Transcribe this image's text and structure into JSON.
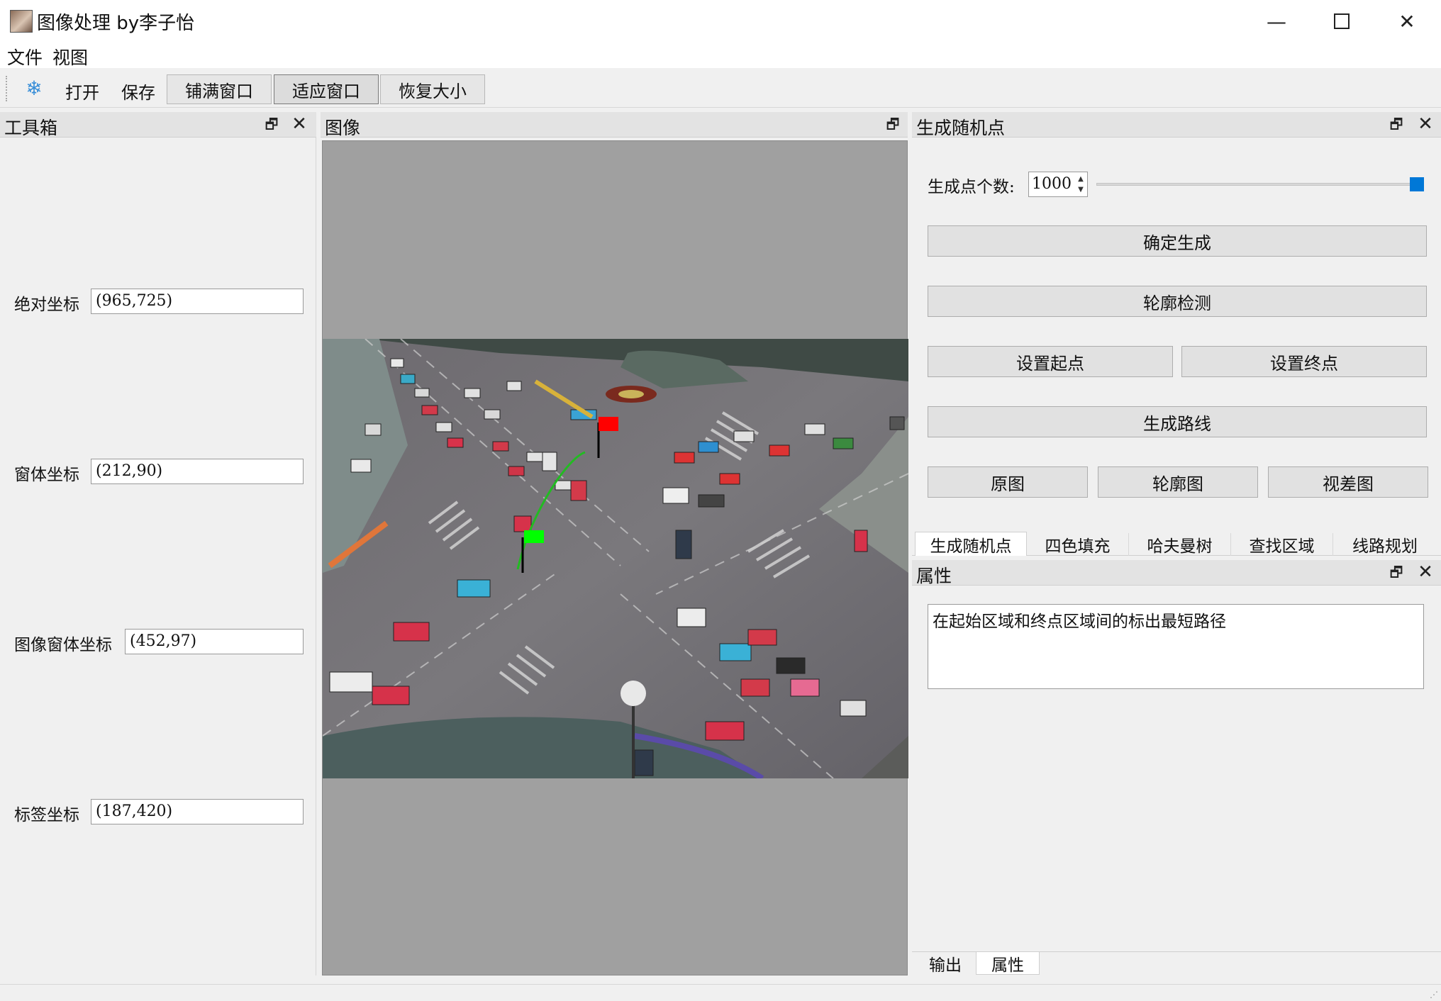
{
  "window": {
    "title": "图像处理 by李子怡",
    "minimize_glyph": "—",
    "close_glyph": "✕"
  },
  "menu": {
    "file": "文件",
    "view": "视图"
  },
  "toolbar": {
    "open": "打开",
    "save": "保存",
    "fill_window": "铺满窗口",
    "fit_window": "适应窗口",
    "restore_size": "恢复大小",
    "icon": "snowflake-icon"
  },
  "toolbox": {
    "title": "工具箱",
    "float_glyph": "🗗",
    "close_glyph": "✕",
    "fields": [
      {
        "label": "绝对坐标",
        "value": "(965,725)"
      },
      {
        "label": "窗体坐标",
        "value": "(212,90)"
      },
      {
        "label": "图像窗体坐标",
        "value": "(452,97)"
      },
      {
        "label": "标签坐标",
        "value": "(187,420)"
      }
    ]
  },
  "image_panel": {
    "title": "图像",
    "float_glyph": "🗗"
  },
  "generate_panel": {
    "title": "生成随机点",
    "float_glyph": "🗗",
    "close_glyph": "✕",
    "count_label": "生成点个数:",
    "count_value": "1000",
    "slider_fraction": 1.0,
    "buttons": {
      "confirm": "确定生成",
      "contour_detect": "轮廓检测",
      "set_start": "设置起点",
      "set_end": "设置终点",
      "gen_route": "生成路线",
      "original": "原图",
      "contour_image": "轮廓图",
      "disparity": "视差图"
    },
    "tabs": [
      "生成随机点",
      "四色填充",
      "哈夫曼树",
      "查找区域",
      "线路规划"
    ],
    "active_tab": 0
  },
  "property_panel": {
    "title": "属性",
    "float_glyph": "🗗",
    "close_glyph": "✕",
    "text": "在起始区域和终点区域间的标出最短路径"
  },
  "bottom_tabs": [
    "输出",
    "属性"
  ],
  "colors": {
    "accent": "#0078d7",
    "start_flag": "#00ff00",
    "end_flag": "#ff0000",
    "route": "#22bb22"
  }
}
